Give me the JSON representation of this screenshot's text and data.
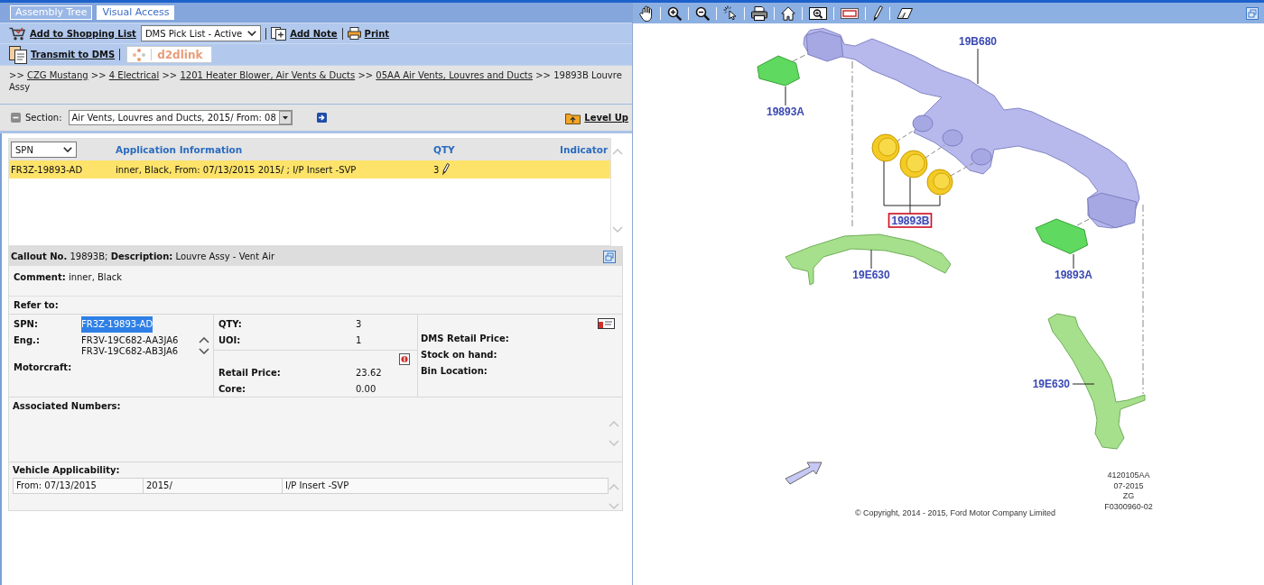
{
  "left_panel": {
    "tabs": [
      {
        "label": "Assembly Tree",
        "selected": false
      },
      {
        "label": "Visual Access",
        "selected": true
      }
    ],
    "toolbar": {
      "add_to_shopping_list": "Add to Shopping List",
      "pick_list": "DMS Pick List - Active",
      "add_note": "Add Note",
      "print": "Print",
      "transmit_to_dms": "Transmit to DMS",
      "d2dlink": "d2dlink"
    },
    "breadcrumb": [
      {
        "separator": ">>",
        "label": "CZG Mustang",
        "kind": "link"
      },
      {
        "separator": ">>",
        "label": "4 Electrical",
        "kind": "link"
      },
      {
        "separator": ">>",
        "label": "1201 Heater Blower, Air Vents & Ducts",
        "kind": "link"
      },
      {
        "separator": ">>",
        "label": "05AA Air Vents, Louvres and Ducts",
        "kind": "link"
      },
      {
        "separator": ">>",
        "label": "19893B Louvre Assy",
        "kind": "current"
      }
    ],
    "section": {
      "label": "Section:",
      "value": "Air Vents, Louvres and Ducts, 2015/ From: 08",
      "level_up": "Level Up"
    },
    "parts_table": {
      "filter": "SPN",
      "columns": [
        "Application Information",
        "QTY",
        "Indicator"
      ],
      "rows": [
        {
          "spn": "FR3Z-19893-AD",
          "application_information": "inner, Black, From: 07/13/2015 2015/ ; I/P Insert -SVP",
          "qty": "3",
          "selected": true
        }
      ]
    },
    "detail": {
      "header": "**Callout No.** 19893B; **Description:** Louvre Assy - Vent Air",
      "comment": "**Comment:** inner, Black",
      "refer_to": "Refer to:",
      "spn": {
        "label": "SPN:",
        "value": "FR3Z-19893-AD",
        "highlighted": true
      },
      "eng": {
        "label": "Eng.:",
        "values": [
          "FR3V-19C682-AA3JA6",
          "FR3V-19C682-AB3JA6"
        ]
      },
      "motorcraft": "Motorcraft:",
      "qty": {
        "label": "QTY:",
        "value": "3"
      },
      "uoi": {
        "label": "UOI:",
        "value": "1"
      },
      "retail_price": {
        "label": "Retail Price:",
        "value": "23.62"
      },
      "core": {
        "label": "Core:",
        "value": "0.00"
      },
      "dms_retail_price": "DMS Retail Price:",
      "stock_on_hand": "Stock on hand:",
      "bin_location": "Bin Location:",
      "associated_numbers": "Associated Numbers:",
      "vehicle_applicability": {
        "label": "Vehicle Applicability:",
        "rows": [
          [
            "From: 07/13/2015",
            "2015/",
            "I/P Insert -SVP"
          ]
        ]
      }
    }
  },
  "right_panel": {
    "diagram": {
      "callouts": [
        {
          "label": "19B680",
          "selected": false
        },
        {
          "label": "19893A",
          "selected": false
        },
        {
          "label": "19893B",
          "selected": true
        },
        {
          "label": "19E630",
          "selected": false
        },
        {
          "label": "19893A",
          "selected": false
        },
        {
          "label": "19E630",
          "selected": false
        }
      ],
      "drawing_info": [
        "4120105AA",
        "07-2015",
        "ZG",
        "F0300960-02"
      ],
      "copyright": "© Copyright, 2014 - 2015, Ford Motor Company Limited"
    }
  }
}
